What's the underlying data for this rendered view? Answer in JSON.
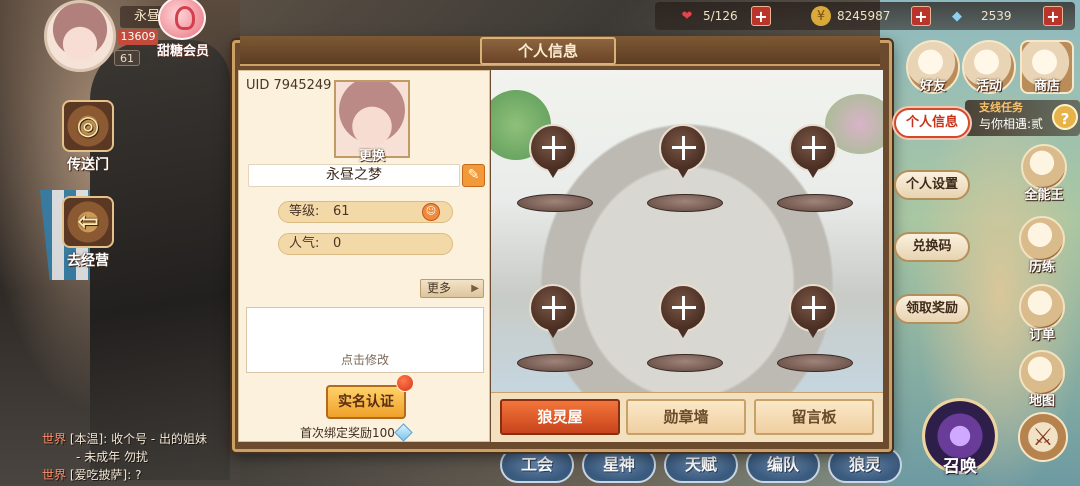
{
  "player": {
    "name": "永昼",
    "exp_text": "13609",
    "level": "61",
    "vip_label": "甜糖会员"
  },
  "left_nav": [
    {
      "label": "传送门",
      "icon": "portal-icon"
    },
    {
      "label": "去经营",
      "icon": "back-arrow-icon"
    }
  ],
  "chat": [
    {
      "channel": "世界",
      "text": "[本温]: 收个号 - 出的姐妹"
    },
    {
      "channel": "",
      "text": "- 未成年 勿扰"
    },
    {
      "channel": "世界",
      "text": "[爱吃披萨]: ?"
    }
  ],
  "currencies": [
    {
      "name": "stamina",
      "icon": "heart-icon",
      "value": "5/126",
      "color": "#e8434a"
    },
    {
      "name": "gold",
      "icon": "coin-icon",
      "value": "8245987",
      "color": "#d9a93a"
    },
    {
      "name": "diamond",
      "icon": "diamond-icon",
      "value": "2539",
      "color": "#8fd0f0"
    }
  ],
  "top_right": [
    {
      "label": "好友",
      "icon": "friends-icon"
    },
    {
      "label": "活动",
      "icon": "event-icon"
    },
    {
      "label": "商店",
      "icon": "shop-icon"
    }
  ],
  "quest": {
    "title": "支线任务",
    "subtitle": "与你相遇:贰",
    "mark": "?"
  },
  "right_icons": [
    {
      "label": "全能王",
      "icon": "pirate-hat-icon"
    },
    {
      "label": "历练",
      "icon": "training-icon"
    },
    {
      "label": "订单",
      "icon": "order-icon"
    },
    {
      "label": "地图",
      "icon": "map-icon"
    }
  ],
  "bottom_menu": [
    {
      "label": "工会"
    },
    {
      "label": "星神"
    },
    {
      "label": "天赋"
    },
    {
      "label": "编队"
    },
    {
      "label": "狼灵"
    }
  ],
  "summon_label": "召唤",
  "dialog": {
    "title": "个人信息",
    "uid_label": "UID",
    "uid_value": "7945249",
    "change_label": "更换",
    "nickname": "永昼之梦",
    "level_label": "等级:",
    "level_value": "61",
    "popularity_label": "人气:",
    "popularity_value": "0",
    "more_label": "更多",
    "signature_hint": "点击修改",
    "verify_label": "实名认证",
    "bind_reward": "首次绑定奖励100",
    "tabs": [
      {
        "label": "狼灵屋",
        "active": true
      },
      {
        "label": "勋章墙",
        "active": false
      },
      {
        "label": "留言板",
        "active": false
      }
    ],
    "side_tabs": [
      {
        "label": "个人信息",
        "active": true
      },
      {
        "label": "个人设置",
        "active": false
      },
      {
        "label": "兑换码",
        "active": false
      },
      {
        "label": "领取奖励",
        "active": false
      }
    ]
  }
}
